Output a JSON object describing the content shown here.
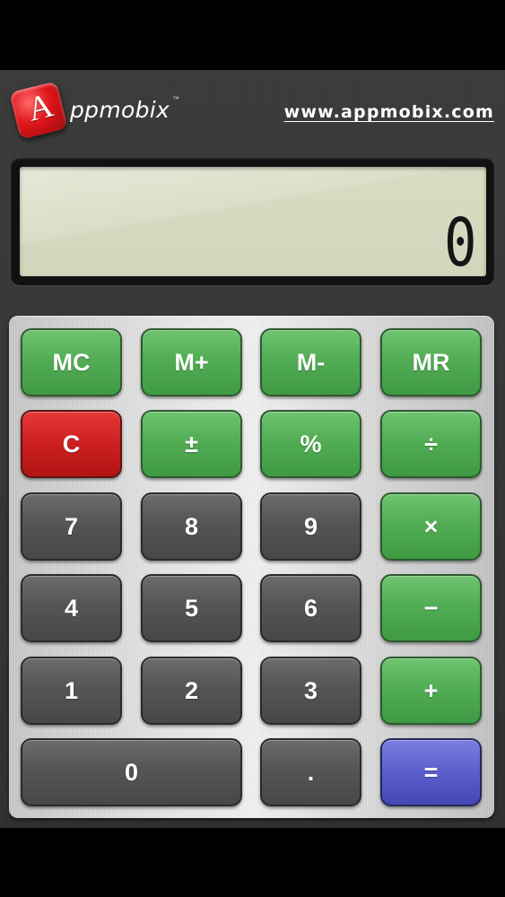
{
  "header": {
    "logo_letter": "A",
    "logo_text": "ppmobix",
    "logo_tm": "™",
    "website": "www.appmobix.com"
  },
  "display": {
    "value": "0"
  },
  "keys": {
    "mc": "MC",
    "m_plus": "M+",
    "m_minus": "M-",
    "mr": "MR",
    "clear": "C",
    "plus_minus": "±",
    "percent": "%",
    "divide": "÷",
    "seven": "7",
    "eight": "8",
    "nine": "9",
    "multiply": "×",
    "four": "4",
    "five": "5",
    "six": "6",
    "subtract": "−",
    "one": "1",
    "two": "2",
    "three": "3",
    "add": "+",
    "zero": "0",
    "decimal": ".",
    "equals": "="
  },
  "colors": {
    "memory_keys": "#52ad55",
    "operator_keys": "#52ad55",
    "clear_key": "#cc1f1f",
    "digit_keys": "#555555",
    "equals_key": "#5a5fcc",
    "lcd_background": "#d6d9bf"
  }
}
